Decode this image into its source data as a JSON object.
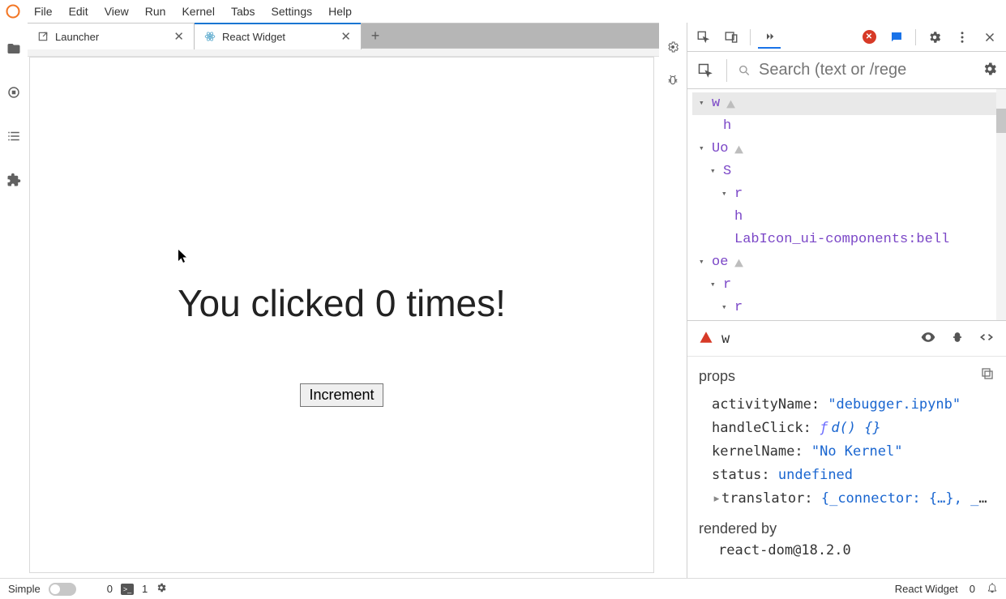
{
  "menu": [
    "File",
    "Edit",
    "View",
    "Run",
    "Kernel",
    "Tabs",
    "Settings",
    "Help"
  ],
  "tabs": [
    {
      "title": "Launcher",
      "active": false
    },
    {
      "title": "React Widget",
      "active": true
    }
  ],
  "react_widget": {
    "heading": "You clicked 0 times!",
    "button": "Increment"
  },
  "statusbar": {
    "simple": "Simple",
    "left_count": "0",
    "terminals": "1",
    "right_label": "React Widget",
    "right_count": "0"
  },
  "devtools": {
    "search_placeholder": "Search (text or /rege",
    "tree": [
      {
        "indent": 0,
        "name": "w",
        "caret": "▾",
        "warn": true,
        "selected": true
      },
      {
        "indent": 1,
        "name": "h",
        "caret": "",
        "warn": false
      },
      {
        "indent": 0,
        "name": "Uo",
        "caret": "▾",
        "warn": true
      },
      {
        "indent": 1,
        "name": "S",
        "caret": "▾",
        "warn": false
      },
      {
        "indent": 2,
        "name": "r",
        "caret": "▾",
        "warn": false
      },
      {
        "indent": 2,
        "name": "h",
        "caret": "",
        "warn": false
      },
      {
        "indent": 2,
        "name": "LabIcon_ui-components:bell",
        "caret": "",
        "warn": false
      },
      {
        "indent": 0,
        "name": "oe",
        "caret": "▾",
        "warn": true
      },
      {
        "indent": 1,
        "name": "r",
        "caret": "▾",
        "warn": false
      },
      {
        "indent": 2,
        "name": "r",
        "caret": "▾",
        "warn": false
      }
    ],
    "selected": {
      "name": "w"
    },
    "props_label": "props",
    "props": [
      {
        "key": "activityName",
        "valtype": "str",
        "val": "\"debugger.ipynb\""
      },
      {
        "key": "handleClick",
        "valtype": "fn",
        "val": "d() {}"
      },
      {
        "key": "kernelName",
        "valtype": "str",
        "val": "\"No Kernel\""
      },
      {
        "key": "status",
        "valtype": "undef",
        "val": "undefined"
      },
      {
        "key": "translator",
        "valtype": "obj",
        "val": "{_connector: {…}, _cu…",
        "caret": "▸"
      }
    ],
    "rendered_by": {
      "label": "rendered by",
      "val": "react-dom@18.2.0"
    }
  }
}
